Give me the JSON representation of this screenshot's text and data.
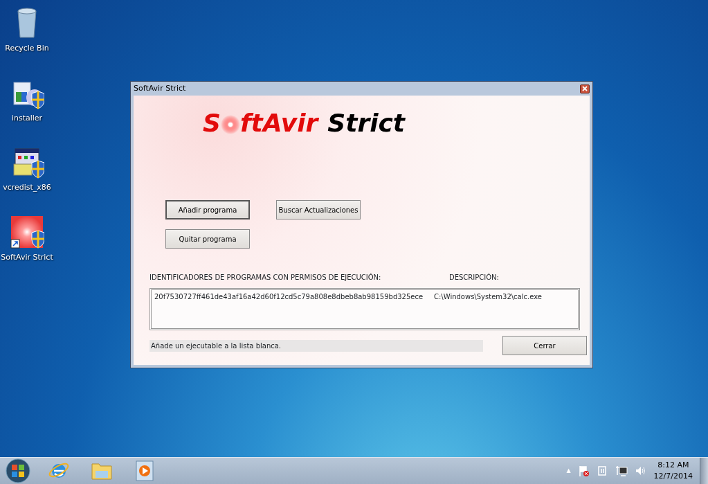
{
  "desktop_icons": [
    {
      "label": "Recycle Bin",
      "kind": "bin"
    },
    {
      "label": "installer",
      "kind": "installer"
    },
    {
      "label": "vcredist_x86",
      "kind": "setup"
    },
    {
      "label": "SoftAvir Strict",
      "kind": "flare"
    }
  ],
  "window": {
    "title": "SoftAvir Strict",
    "logo": {
      "red_start": "S",
      "red_end": "ftAvir",
      "black": "Strict"
    },
    "buttons": [
      {
        "label": "Añadir programa",
        "default": true
      },
      {
        "label": "Buscar Actualizaciones",
        "default": false
      },
      {
        "label": "Quitar programa",
        "default": false
      }
    ],
    "list": {
      "columns": [
        "IDENTIFICADORES DE PROGRAMAS CON PERMISOS DE EJECUCIÓN:",
        "DESCRIPCIÓN:"
      ],
      "rows": [
        {
          "id": "20f7530727ff461de43af16a42d60f12cd5c79a808e8dbeb8ab98159bd325ece",
          "description": "C:\\Windows\\System32\\calc.exe"
        }
      ]
    },
    "status": "Añade un ejecutable a la lista blanca.",
    "close_button": "Cerrar"
  },
  "taskbar": {
    "pinned": [
      {
        "kind": "ie"
      },
      {
        "kind": "folder"
      },
      {
        "kind": "media"
      }
    ],
    "tray": {
      "arrow": "▲",
      "time": "8:12 AM",
      "date": "12/7/2014"
    }
  }
}
